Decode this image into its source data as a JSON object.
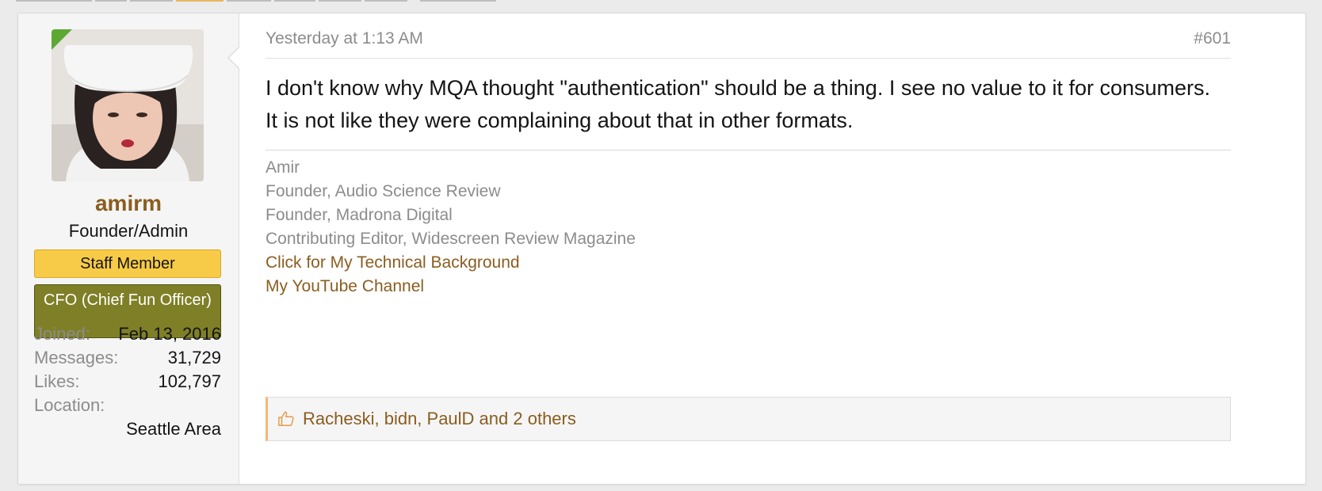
{
  "post": {
    "date": "Yesterday at 1:13 AM",
    "number": "#601",
    "message": "I don't know why MQA thought \"authentication\" should be a thing. I see no value to it for consumers. It is not like they were complaining about that in other formats."
  },
  "user": {
    "name": "amirm",
    "title": "Founder/Admin",
    "banners": {
      "staff": "Staff Member",
      "custom": "CFO (Chief Fun Officer)"
    },
    "info": {
      "joined_label": "Joined:",
      "joined_value": "Feb 13, 2016",
      "messages_label": "Messages:",
      "messages_value": "31,729",
      "likes_label": "Likes:",
      "likes_value": "102,797",
      "location_label": "Location:",
      "location_value": "Seattle Area"
    }
  },
  "signature": {
    "lines": [
      "Amir",
      "Founder, Audio Science Review",
      "Founder, Madrona Digital",
      "Contributing Editor, Widescreen Review Magazine"
    ],
    "links": [
      "Click for My Technical Background",
      "My YouTube Channel"
    ]
  },
  "likes": {
    "icon": "thumbs-up-icon",
    "text": "Racheski, bidn, PaulD and 2 others"
  },
  "colors": {
    "username": "#8a5d20",
    "staff_banner": "#f7cb48",
    "custom_banner": "#7f7f27",
    "online_indicator": "#5ba834",
    "link": "#8a5d20",
    "likes_accent": "#f0b878"
  }
}
